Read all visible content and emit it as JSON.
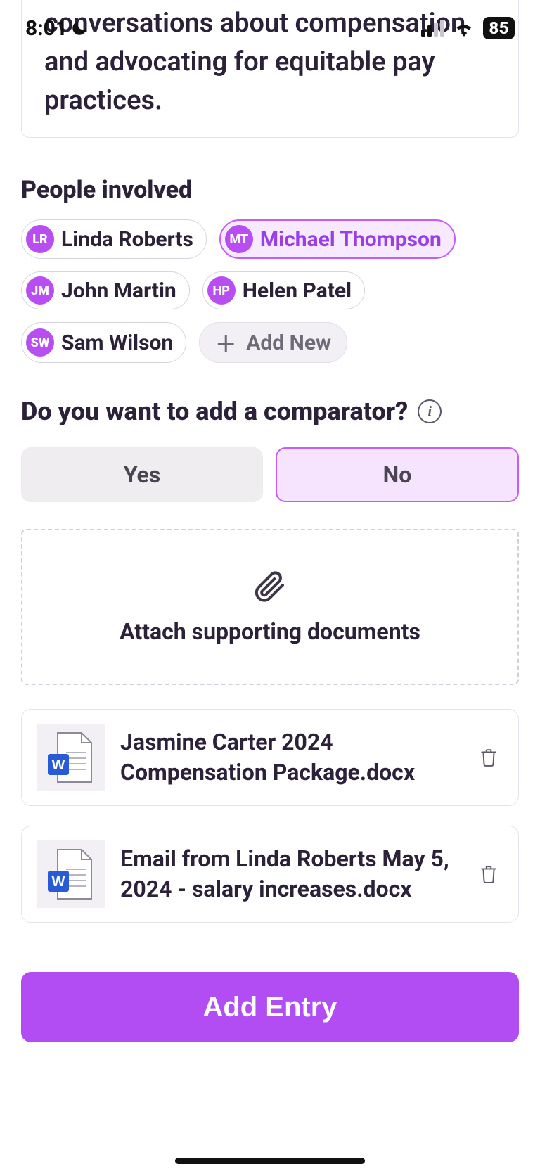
{
  "status": {
    "time": "8:01",
    "battery": "85"
  },
  "description": "conversations about compensation and advocating for equitable pay practices.",
  "people": {
    "title": "People involved",
    "items": [
      {
        "initials": "LR",
        "name": "Linda Roberts",
        "selected": false
      },
      {
        "initials": "MT",
        "name": "Michael Thompson",
        "selected": true
      },
      {
        "initials": "JM",
        "name": "John Martin",
        "selected": false
      },
      {
        "initials": "HP",
        "name": "Helen Patel",
        "selected": false
      },
      {
        "initials": "SW",
        "name": "Sam Wilson",
        "selected": false
      }
    ],
    "add_new_label": "Add New"
  },
  "comparator": {
    "title": "Do you want to add a comparator?",
    "yes_label": "Yes",
    "no_label": "No",
    "selected": "No"
  },
  "attach": {
    "label": "Attach supporting documents"
  },
  "files": [
    {
      "name": "Jasmine Carter 2024 Compensation Package.docx"
    },
    {
      "name": "Email from Linda Roberts May 5, 2024 - salary increases.docx"
    }
  ],
  "submit_label": "Add Entry"
}
